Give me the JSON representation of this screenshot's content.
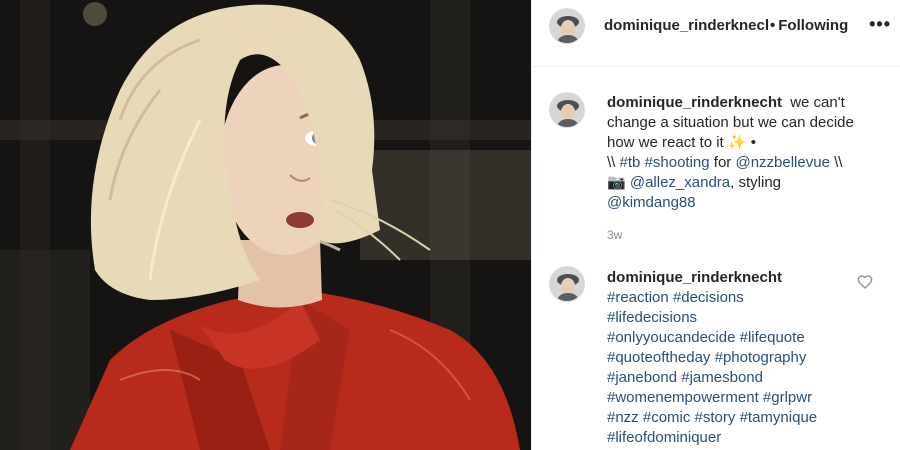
{
  "header": {
    "username": "dominique_rinderknecht",
    "separator": "•",
    "follow_status": "Following",
    "more_icon": "•••"
  },
  "caption": {
    "username": "dominique_rinderknecht",
    "text_1": "we can't change a situation but we can decide how we react to it",
    "emoji": "✨",
    "text_2": "•",
    "text_3": "\\\\",
    "tag_1": "#tb",
    "tag_2": "#shooting",
    "text_4": "for",
    "mention_1": "@nzzbellevue",
    "text_5": "\\\\",
    "camera_emoji": "📷",
    "mention_2": "@allez_xandra",
    "text_6": ", styling",
    "mention_3": "@kimdang88",
    "timestamp": "3w"
  },
  "comment": {
    "username": "dominique_rinderknecht",
    "tags": [
      "#reaction",
      "#decisions",
      "#lifedecisions",
      "#onlyyoucandecide",
      "#lifequote",
      "#quoteoftheday",
      "#photography",
      "#janebond",
      "#jamesbond",
      "#womenempowerment",
      "#grlpwr",
      "#nzz",
      "#comic",
      "#story",
      "#tamynique",
      "#lifeofdominiquer"
    ]
  },
  "colors": {
    "link": "#2d4d7c",
    "text": "#262626",
    "muted": "#8e8e8e",
    "jacket": "#b82a1c",
    "hair": "#e8d9b8"
  },
  "icons": {
    "heart": "heart-outline-icon",
    "more": "more-options-icon"
  }
}
